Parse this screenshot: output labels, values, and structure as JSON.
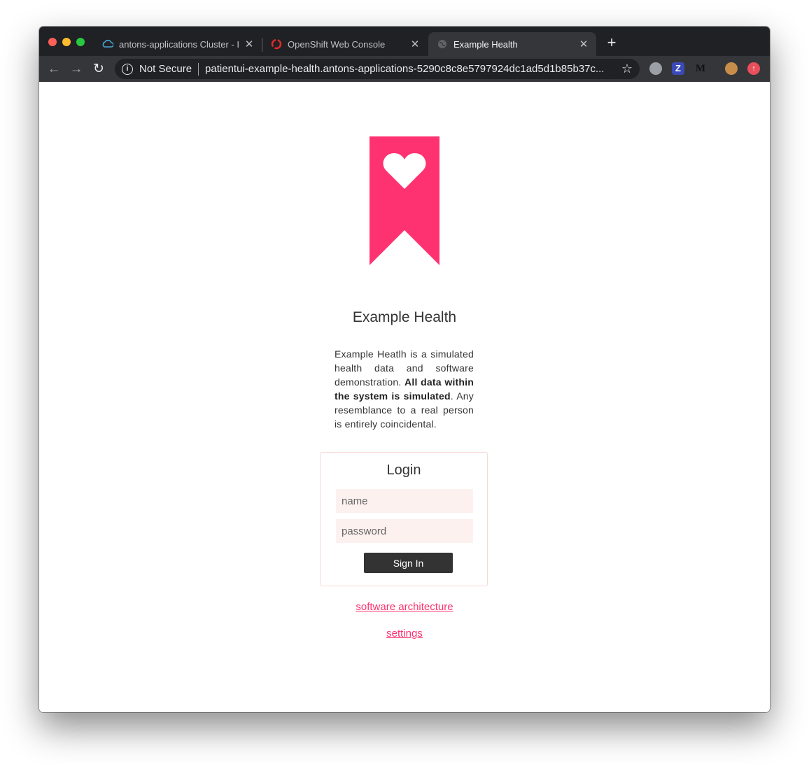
{
  "browser": {
    "tabs": [
      {
        "title": "antons-applications Cluster - IBM Cloud",
        "icon": "ibm-cloud-icon"
      },
      {
        "title": "OpenShift Web Console",
        "icon": "openshift-icon"
      },
      {
        "title": "Example Health",
        "icon": "globe-icon"
      }
    ],
    "new_tab_label": "+",
    "security_label": "Not Secure",
    "url": "patientui-example-health.antons-applications-5290c8c8e5797924dc1ad5d1b85b37c..."
  },
  "page": {
    "brand_color": "#ff3271",
    "title": "Example Health",
    "description": {
      "part1": "Example Heatlh is a simulated health data and software demonstration. ",
      "bold": "All data within the system is simulated",
      "part2": ". Any resemblance to a real person is entirely coincidental."
    },
    "login": {
      "title": "Login",
      "name_placeholder": "name",
      "password_placeholder": "password",
      "signin_label": "Sign In"
    },
    "links": {
      "architecture": "software architecture",
      "settings": "settings"
    }
  }
}
